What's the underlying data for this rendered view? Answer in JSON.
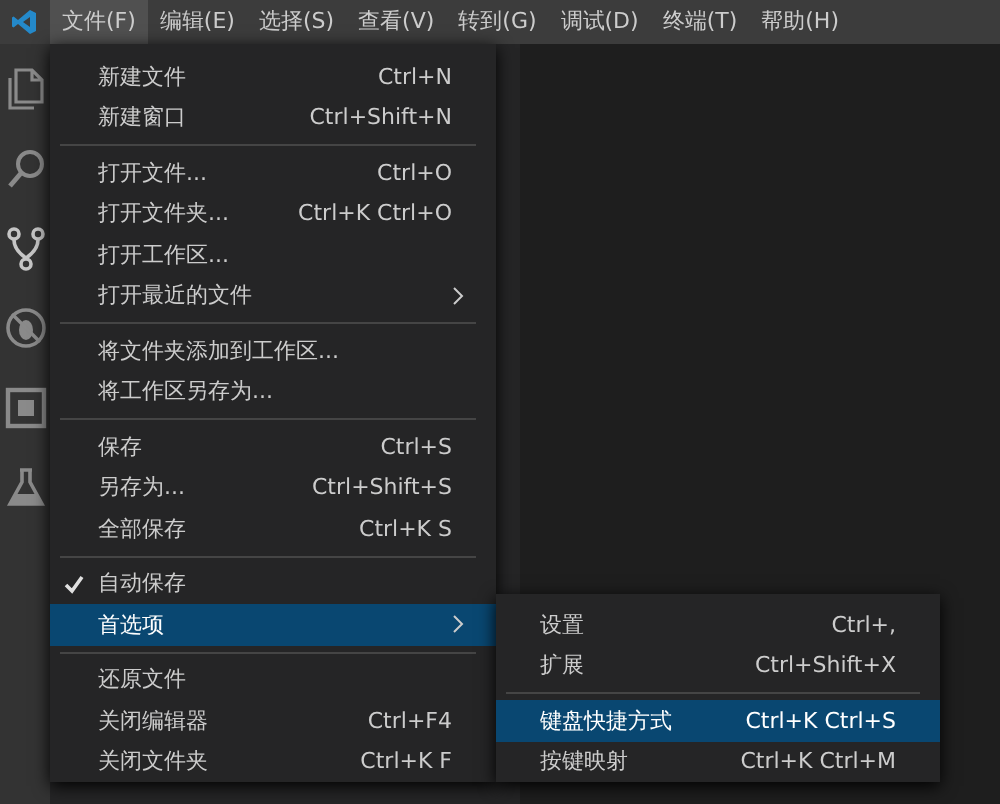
{
  "menubar": [
    {
      "label": "文件(F)",
      "selected": true
    },
    {
      "label": "编辑(E)",
      "selected": false
    },
    {
      "label": "选择(S)",
      "selected": false
    },
    {
      "label": "查看(V)",
      "selected": false
    },
    {
      "label": "转到(G)",
      "selected": false
    },
    {
      "label": "调试(D)",
      "selected": false
    },
    {
      "label": "终端(T)",
      "selected": false
    },
    {
      "label": "帮助(H)",
      "selected": false
    }
  ],
  "activity_bar": [
    {
      "kind": "files"
    },
    {
      "kind": "search"
    },
    {
      "kind": "git"
    },
    {
      "kind": "debug"
    },
    {
      "kind": "extensions"
    },
    {
      "kind": "flask"
    }
  ],
  "file_menu": [
    [
      {
        "label": "新建文件",
        "shortcut": "Ctrl+N",
        "checked": false,
        "submenu": false,
        "selected": false
      },
      {
        "label": "新建窗口",
        "shortcut": "Ctrl+Shift+N",
        "checked": false,
        "submenu": false,
        "selected": false
      }
    ],
    [
      {
        "label": "打开文件...",
        "shortcut": "Ctrl+O",
        "checked": false,
        "submenu": false,
        "selected": false
      },
      {
        "label": "打开文件夹...",
        "shortcut": "Ctrl+K Ctrl+O",
        "checked": false,
        "submenu": false,
        "selected": false
      },
      {
        "label": "打开工作区...",
        "checked": false,
        "submenu": false,
        "selected": false
      },
      {
        "label": "打开最近的文件",
        "checked": false,
        "submenu": true,
        "selected": false
      }
    ],
    [
      {
        "label": "将文件夹添加到工作区...",
        "checked": false,
        "submenu": false,
        "selected": false
      },
      {
        "label": "将工作区另存为...",
        "checked": false,
        "submenu": false,
        "selected": false
      }
    ],
    [
      {
        "label": "保存",
        "shortcut": "Ctrl+S",
        "checked": false,
        "submenu": false,
        "selected": false
      },
      {
        "label": "另存为...",
        "shortcut": "Ctrl+Shift+S",
        "checked": false,
        "submenu": false,
        "selected": false
      },
      {
        "label": "全部保存",
        "shortcut": "Ctrl+K S",
        "checked": false,
        "submenu": false,
        "selected": false
      }
    ],
    [
      {
        "label": "自动保存",
        "checked": true,
        "submenu": false,
        "selected": false
      },
      {
        "label": "首选项",
        "checked": false,
        "submenu": true,
        "selected": true
      }
    ],
    [
      {
        "label": "还原文件",
        "checked": false,
        "submenu": false,
        "selected": false
      },
      {
        "label": "关闭编辑器",
        "shortcut": "Ctrl+F4",
        "checked": false,
        "submenu": false,
        "selected": false
      },
      {
        "label": "关闭文件夹",
        "shortcut": "Ctrl+K F",
        "checked": false,
        "submenu": false,
        "selected": false
      }
    ]
  ],
  "preferences_submenu": [
    [
      {
        "label": "设置",
        "shortcut": "Ctrl+,",
        "selected": false
      },
      {
        "label": "扩展",
        "shortcut": "Ctrl+Shift+X",
        "selected": false
      }
    ],
    [
      {
        "label": "键盘快捷方式",
        "shortcut": "Ctrl+K Ctrl+S",
        "selected": true
      },
      {
        "label": "按键映射",
        "shortcut": "Ctrl+K Ctrl+M",
        "selected": false
      }
    ]
  ]
}
